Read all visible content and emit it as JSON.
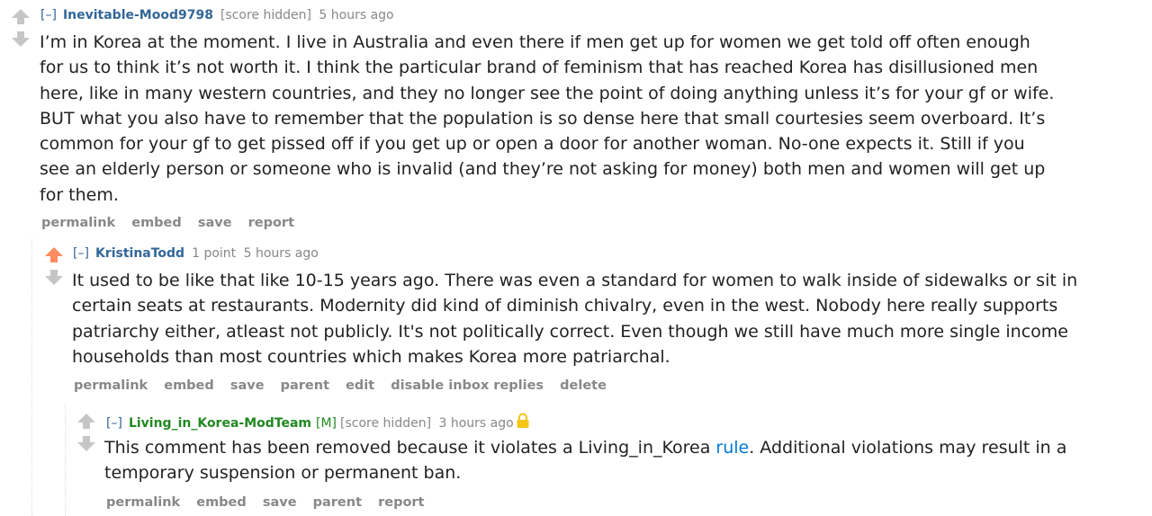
{
  "comments": [
    {
      "expand": "[–]",
      "author": "Inevitable-Mood9798",
      "score": "[score hidden]",
      "time": "5 hours ago",
      "lines": [
        "I’m in Korea at the moment. I live in Australia and even there if men get up for women we get told off often enough",
        "for us to think it’s not worth it. I think the particular brand of feminism that has reached Korea has disillusioned men",
        "here, like in many western countries, and they no longer see the point of doing anything unless it’s for your gf or wife.",
        "BUT what you also have to remember that the population is so dense here that small courtesies seem overboard. It’s",
        "common for your gf to get pissed off if you get up or open a door for another woman. No-one expects it. Still if you",
        "see an elderly person or someone who is invalid (and they’re not asking for money) both men and women will get up",
        "for them."
      ],
      "buttons": [
        "permalink",
        "embed",
        "save",
        "report"
      ]
    },
    {
      "expand": "[–]",
      "author": "KristinaTodd",
      "score": "1 point",
      "time": "5 hours ago",
      "lines": [
        "It used to be like that like 10-15 years ago. There was even a standard for women to walk inside of sidewalks or sit in",
        "certain seats at restaurants. Modernity did kind of diminish chivalry, even in the west. Nobody here really supports",
        "patriarchy either, atleast not publicly. It's not politically correct. Even though we still have much more single income",
        "households than most countries which makes Korea more patriarchal."
      ],
      "buttons": [
        "permalink",
        "embed",
        "save",
        "parent",
        "edit",
        "disable inbox replies",
        "delete"
      ]
    },
    {
      "expand": "[–]",
      "author": "Living_in_Korea-ModTeam",
      "mod_flag": "[M]",
      "score": "[score hidden]",
      "time": "3 hours ago",
      "line1_before": "This comment has been removed because it violates a Living_in_Korea ",
      "line1_link": "rule",
      "line1_after": ". Additional violations may result in a",
      "line2": "temporary suspension or permanent ban.",
      "buttons": [
        "permalink",
        "embed",
        "save",
        "parent",
        "report"
      ]
    }
  ],
  "colors": {
    "upvote_active": "#ff8b60",
    "arrow_inactive": "#c6c6c6",
    "author": "#336699",
    "mod_author": "#228822",
    "lock": "#f5c518"
  }
}
